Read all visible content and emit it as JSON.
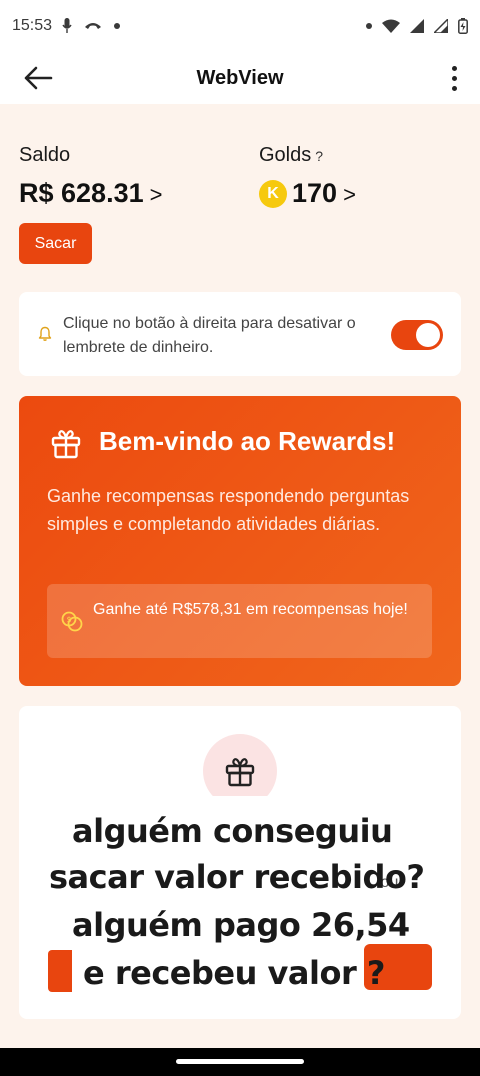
{
  "status_bar": {
    "time": "15:53",
    "left_icons": [
      "microphone-icon",
      "call-icon",
      "dot-icon"
    ],
    "right_icons": [
      "dot-icon",
      "wifi-icon",
      "signal-icon",
      "signal-icon",
      "battery-icon"
    ]
  },
  "app_bar": {
    "title": "WebView",
    "back_icon": "arrow-left-icon",
    "menu_icon": "more-vertical-icon"
  },
  "wallet": {
    "saldo_label": "Saldo",
    "saldo_value": "R$ 628.31",
    "saldo_chevron": ">",
    "golds_label": "Golds",
    "golds_help": "?",
    "golds_coin_letter": "K",
    "golds_value": "170",
    "golds_chevron": ">",
    "withdraw_button": "Sacar"
  },
  "reminder": {
    "icon": "bell-icon",
    "text": "Clique no botão à direita para desativar o lembrete de dinheiro.",
    "toggle_on": true
  },
  "rewards": {
    "icon": "gift-icon",
    "title": "Bem-vindo ao Rewards!",
    "description": "Ganhe recompensas respondendo perguntas simples e completando atividades diárias.",
    "earn_icon": "coins-icon",
    "earn_text": "Ganhe até R$578,31 em recompensas hoje!"
  },
  "question_card": {
    "icon": "gift-icon",
    "overlay_lines": [
      "alguém conseguiu",
      "sacar valor recebido?",
      "alguém pago 26,54",
      "e recebeu valor ?"
    ],
    "partial_text": "iou"
  },
  "colors": {
    "accent": "#e8450f",
    "page_background": "#fdf3ec",
    "coin": "#f6c90e"
  }
}
